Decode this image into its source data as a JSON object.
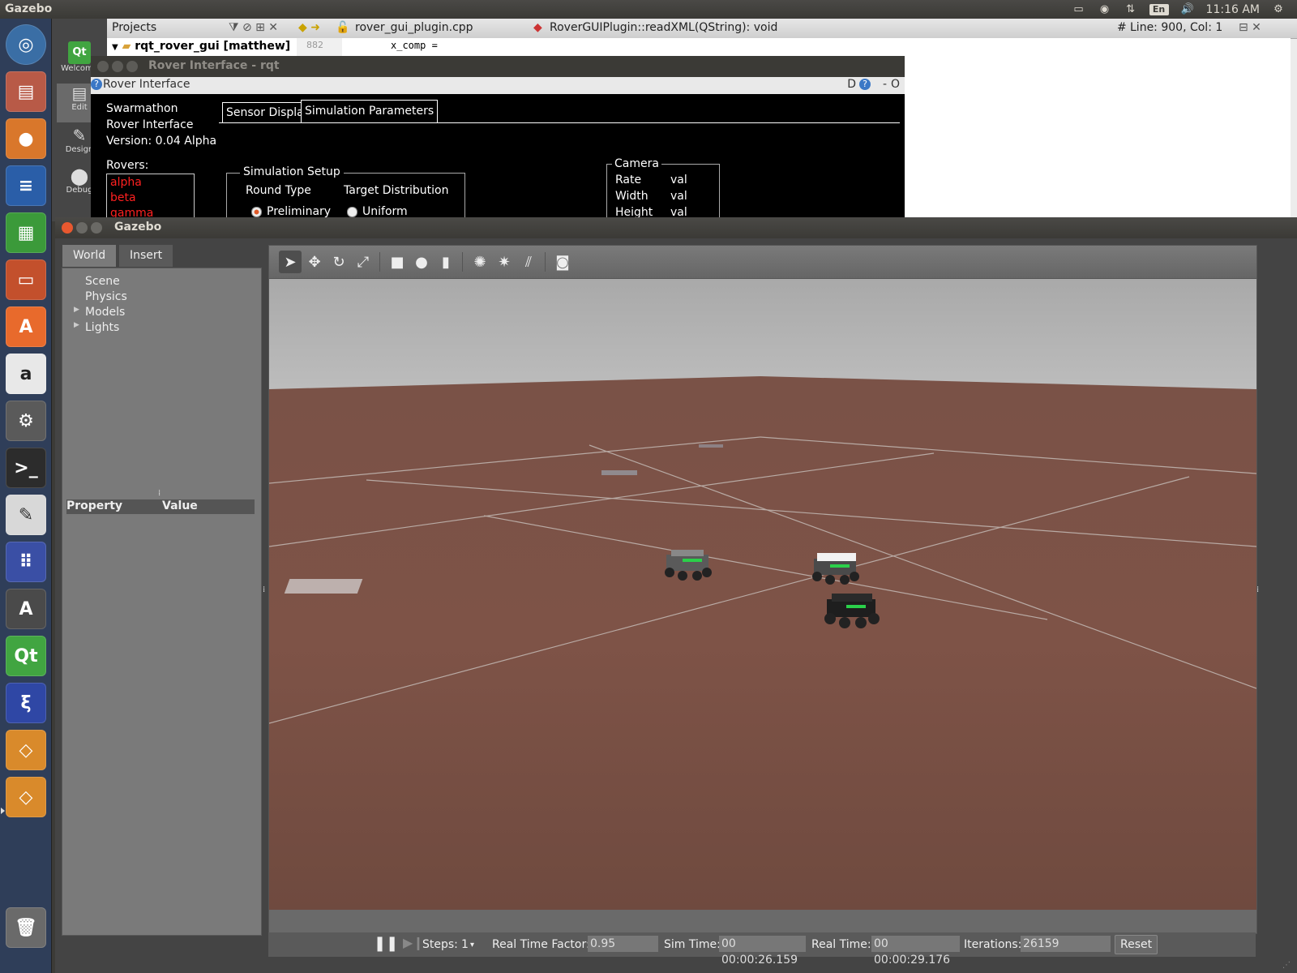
{
  "system": {
    "active_app": "Gazebo",
    "clock": "11:16 AM",
    "keyboard": "En"
  },
  "qtcreator": {
    "projects_label": "Projects",
    "project_root": "rqt_rover_gui [matthew]",
    "file": "rover_gui_plugin.cpp",
    "function": "RoverGUIPlugin::readXML(QString): void",
    "cursor": "Line: 900, Col: 1",
    "line_number": "882",
    "code_line": "x_comp =",
    "modes": [
      "Welcome",
      "Edit",
      "Design",
      "Debug"
    ]
  },
  "rqt": {
    "window_title": "Rover Interface - rqt",
    "dock_title": "Rover Interface",
    "dock_buttons": "D",
    "app_name_line1": "Swarmathon",
    "app_name_line2": "Rover Interface",
    "version_label": "Version:",
    "version": "0.04 Alpha",
    "tabs": [
      "Sensor Display",
      "Simulation Parameters"
    ],
    "rovers_label": "Rovers:",
    "rovers": [
      "alpha",
      "beta",
      "gamma"
    ],
    "sim_setup": {
      "title": "Simulation Setup",
      "round_type_label": "Round Type",
      "target_dist_label": "Target Distribution",
      "round_type_value": "Preliminary",
      "target_dist_value": "Uniform"
    },
    "camera": {
      "title": "Camera",
      "rows": [
        {
          "label": "Rate",
          "value": "val"
        },
        {
          "label": "Width",
          "value": "val"
        },
        {
          "label": "Height",
          "value": "val"
        }
      ]
    }
  },
  "gazebo": {
    "window_title": "Gazebo",
    "tabs": [
      "World",
      "Insert"
    ],
    "tree": [
      "Scene",
      "Physics",
      "Models",
      "Lights"
    ],
    "property_col": "Property",
    "value_col": "Value",
    "status": {
      "steps_label": "Steps:",
      "steps_value": "1",
      "rtf_label": "Real Time Factor:",
      "rtf_value": "0.95",
      "sim_time_label": "Sim Time:",
      "sim_time_value": "00 00:00:26.159",
      "real_time_label": "Real Time:",
      "real_time_value": "00 00:00:29.176",
      "iterations_label": "Iterations:",
      "iterations_value": "26159",
      "reset_label": "Reset"
    },
    "toolbar_icons": [
      "select-tool-icon",
      "translate-tool-icon",
      "rotate-tool-icon",
      "scale-tool-icon",
      "box-icon",
      "sphere-icon",
      "cylinder-icon",
      "point-light-icon",
      "spot-light-icon",
      "directional-light-icon",
      "screenshot-icon"
    ]
  },
  "colors": {
    "rover_name": "#ff2020",
    "ground": "#7b5246",
    "sky": "#b7b7b7"
  }
}
